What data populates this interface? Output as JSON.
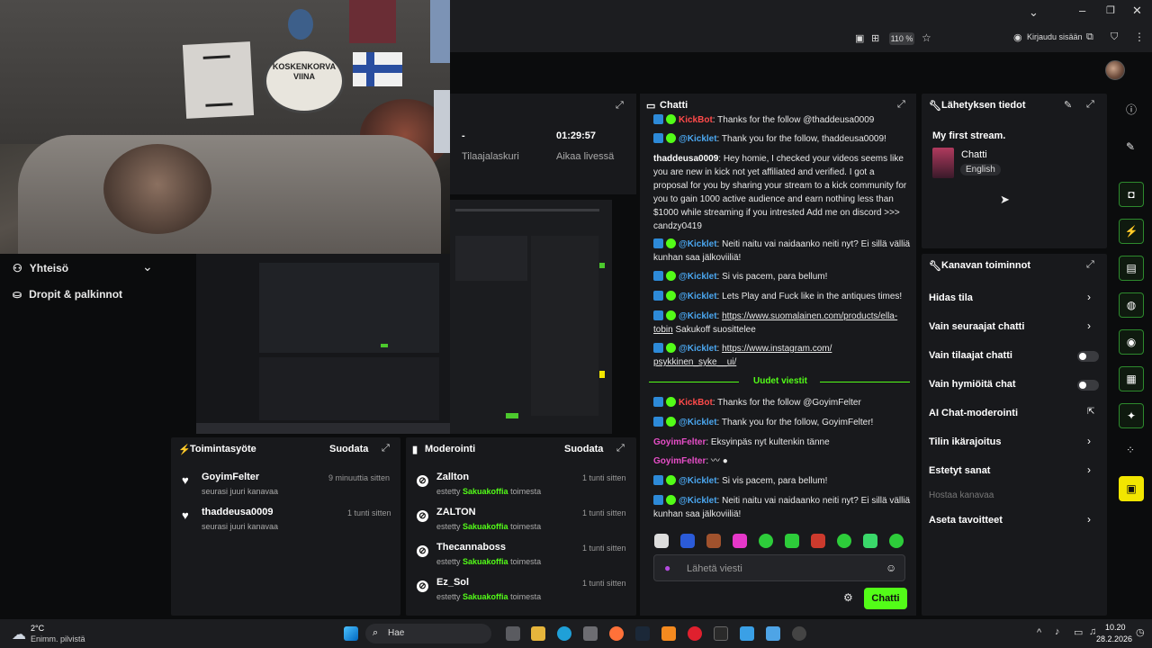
{
  "browser": {
    "zoom": "110 %",
    "login": "Kirjaudu sisään"
  },
  "video": {
    "label_line1": "KOSKENKORVA",
    "label_line2": "VIINA"
  },
  "stats": [
    {
      "value": "-",
      "label": "Tilaajalaskuri"
    },
    {
      "value": "01:29:57",
      "label": "Aikaa livessä"
    }
  ],
  "left_nav": [
    {
      "label": "Yhteisö"
    },
    {
      "label": "Dropit & palkinnot"
    }
  ],
  "activity": {
    "title": "Toimintasyöte",
    "filter": "Suodata",
    "items": [
      {
        "name": "GoyimFelter",
        "sub": "seurasi juuri kanavaa",
        "time": "9 minuuttia sitten"
      },
      {
        "name": "thaddeusa0009",
        "sub": "seurasi juuri kanavaa",
        "time": "1 tunti sitten"
      }
    ]
  },
  "moderation": {
    "title": "Moderointi",
    "filter": "Suodata",
    "items": [
      {
        "name": "Zallton",
        "pre": "estetty",
        "by": "Sakuakoffia",
        "post": "toimesta",
        "time": "1 tunti sitten"
      },
      {
        "name": "ZALTON",
        "pre": "estetty",
        "by": "Sakuakoffia",
        "post": "toimesta",
        "time": "1 tunti sitten"
      },
      {
        "name": "Thecannaboss",
        "pre": "estetty",
        "by": "Sakuakoffia",
        "post": "toimesta",
        "time": "1 tunti sitten"
      },
      {
        "name": "Ez_Sol",
        "pre": "estetty",
        "by": "Sakuakoffia",
        "post": "toimesta",
        "time": "1 tunti sitten"
      }
    ]
  },
  "chat": {
    "title": "Chatti",
    "new_messages": "Uudet viestit",
    "input_placeholder": "Lähetä viesti",
    "send": "Chatti",
    "messages": [
      {
        "user": "KickBot",
        "text": ": Thanks for the follow @thaddeusa0009"
      },
      {
        "user": "@Kicklet",
        "text": ": Thank you for the follow, thaddeusa0009!"
      },
      {
        "user": "thaddeusa0009",
        "text": ": Hey homie, I checked your videos seems like you are new in kick not yet affiliated and verified. I got a proposal for you by sharing your stream to a kick community for you to gain 1000 active audience and earn nothing less than $1000 while streaming if you intrested Add me on discord >>> candzy0419"
      },
      {
        "user": "@Kicklet",
        "text": ": Neiti naitu vai naidaanko neiti nyt? Ei sillä välliä kunhan saa jälkoviiliä!"
      },
      {
        "user": "@Kicklet",
        "text": ": Si vis pacem, para bellum!"
      },
      {
        "user": "@Kicklet",
        "text": ": Lets Play and Fuck like in the antiques times!"
      },
      {
        "user": "@Kicklet",
        "text": ": ",
        "link": "https://www.suomalainen.com/products/ella-tobin",
        "after": " Sakukoff suosittelee"
      },
      {
        "user": "@Kicklet",
        "text": ": ",
        "link": "https://www.instagram.com/ psykkinen_syke__ui/",
        "after": ""
      },
      {
        "user": "KickBot",
        "text": ": Thanks for the follow @GoyimFelter"
      },
      {
        "user": "@Kicklet",
        "text": ": Thank you for the follow, GoyimFelter!"
      },
      {
        "user": "GoyimFelter",
        "text": ": Eksyinpäs nyt kultenkin tänne"
      },
      {
        "user": "GoyimFelter",
        "text": ": "
      },
      {
        "user": "@Kicklet",
        "text": ": Si vis pacem, para bellum!"
      },
      {
        "user": "@Kicklet",
        "text": ": Neiti naitu vai naidaanko neiti nyt? Ei sillä välliä kunhan saa jälkoviiliä!"
      }
    ]
  },
  "stream_info": {
    "title": "Lähetyksen tiedot",
    "stream_title": "My first stream.",
    "category": "Chatti",
    "language": "English"
  },
  "channel_actions": {
    "title": "Kanavan toiminnot",
    "items": [
      {
        "label": "Hidas tila",
        "kind": "chevron"
      },
      {
        "label": "Vain seuraajat chatti",
        "kind": "chevron"
      },
      {
        "label": "Vain tilaajat chatti",
        "kind": "toggle"
      },
      {
        "label": "Vain hymiöitä chat",
        "kind": "toggle"
      },
      {
        "label": "AI Chat-moderointi",
        "kind": "external"
      },
      {
        "label": "Tilin ikärajoitus",
        "kind": "chevron"
      },
      {
        "label": "Estetyt sanat",
        "kind": "chevron"
      },
      {
        "label": "Hostaa kanavaa",
        "kind": "disabled"
      },
      {
        "label": "Aseta tavoitteet",
        "kind": "chevron"
      }
    ]
  },
  "taskbar": {
    "weather_temp": "2°C",
    "weather_desc": "Enimm. pilvistä",
    "search": "Hae",
    "time": "10.20",
    "date": "28.2.2026"
  },
  "colors": {
    "accent": "#53fc18",
    "panel": "#18191c",
    "background": "#0b0c0d"
  }
}
